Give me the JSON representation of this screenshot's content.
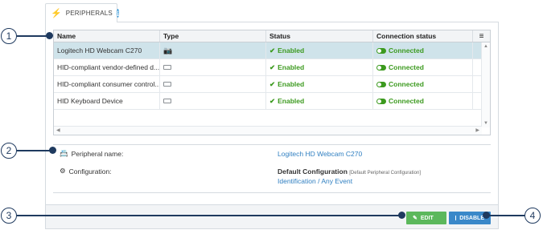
{
  "tab": {
    "label": "PERIPHERALS",
    "info_badge": "i",
    "icon": "plug-icon"
  },
  "grid": {
    "columns": [
      "Name",
      "Type",
      "Status",
      "Connection status"
    ],
    "menu_icon": "≡",
    "rows": [
      {
        "name": "Logitech HD Webcam C270",
        "type_icon": "camera-icon",
        "status": "Enabled",
        "connection": "Connected",
        "selected": true
      },
      {
        "name": "HID-compliant vendor-defined d...",
        "type_icon": "keyboard-icon",
        "status": "Enabled",
        "connection": "Connected",
        "selected": false
      },
      {
        "name": "HID-compliant consumer control...",
        "type_icon": "keyboard-icon",
        "status": "Enabled",
        "connection": "Connected",
        "selected": false
      },
      {
        "name": "HID Keyboard Device",
        "type_icon": "keyboard-icon",
        "status": "Enabled",
        "connection": "Connected",
        "selected": false
      }
    ]
  },
  "details": {
    "peripheral_name_label": "Peripheral name:",
    "peripheral_name_value": "Logitech HD Webcam C270",
    "configuration_label": "Configuration:",
    "configuration_value": "Default Configuration",
    "configuration_note": "[Default Peripheral Configuration]",
    "configuration_link": "Identification / Any Event"
  },
  "footer": {
    "edit_label": "EDIT",
    "disable_label": "DISABLE"
  },
  "callouts": [
    "1",
    "2",
    "3",
    "4"
  ],
  "colors": {
    "accent": "#3a88c9",
    "success": "#5cb85c",
    "selected_row": "#cfe3ea",
    "callout": "#1f3a5f"
  }
}
